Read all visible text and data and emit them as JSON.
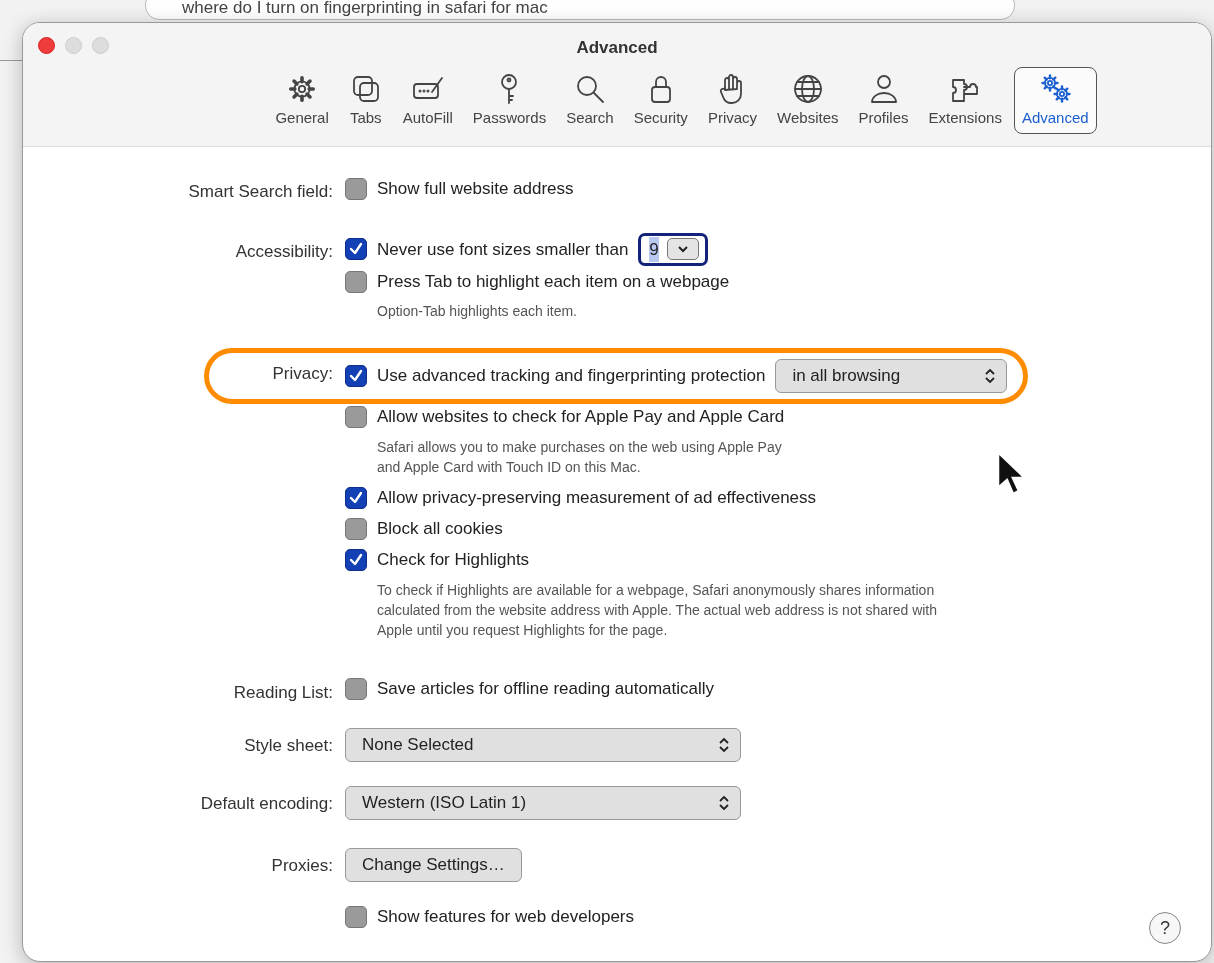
{
  "background": {
    "search_query": "where do I turn on fingerprinting in safari for mac"
  },
  "window": {
    "title": "Advanced"
  },
  "toolbar": [
    {
      "label": "General",
      "selected": false
    },
    {
      "label": "Tabs",
      "selected": false
    },
    {
      "label": "AutoFill",
      "selected": false
    },
    {
      "label": "Passwords",
      "selected": false
    },
    {
      "label": "Search",
      "selected": false
    },
    {
      "label": "Security",
      "selected": false
    },
    {
      "label": "Privacy",
      "selected": false
    },
    {
      "label": "Websites",
      "selected": false
    },
    {
      "label": "Profiles",
      "selected": false
    },
    {
      "label": "Extensions",
      "selected": false
    },
    {
      "label": "Advanced",
      "selected": true
    }
  ],
  "sections": [
    {
      "label": "Smart Search field:",
      "rows": [
        {
          "kind": "checkbox",
          "text": "Show full website address",
          "checked": false
        }
      ]
    },
    {
      "label": "Accessibility:",
      "rows": [
        {
          "kind": "checkbox",
          "text": "Never use font sizes smaller than",
          "checked": true,
          "stepper": {
            "value": "9"
          }
        },
        {
          "kind": "checkbox",
          "text": "Press Tab to highlight each item on a webpage",
          "checked": false,
          "note": "Option-Tab highlights each item."
        }
      ]
    },
    {
      "label": "Privacy:",
      "rows": [
        {
          "kind": "checkbox",
          "text": "Use advanced tracking and fingerprinting protection",
          "checked": true,
          "highlighted": true,
          "popup": {
            "value": "in all browsing"
          }
        },
        {
          "kind": "checkbox",
          "text": "Allow websites to check for Apple Pay and Apple Card",
          "checked": false,
          "note": "Safari allows you to make purchases on the web using Apple Pay\nand Apple Card with Touch ID on this Mac."
        },
        {
          "kind": "checkbox",
          "text": "Allow privacy-preserving measurement of ad effectiveness",
          "checked": true
        },
        {
          "kind": "checkbox",
          "text": "Block all cookies",
          "checked": false
        },
        {
          "kind": "checkbox",
          "text": "Check for Highlights",
          "checked": true,
          "note": "To check if Highlights are available for a webpage, Safari anonymously shares information\ncalculated from the website address with Apple. The actual web address is not shared with\nApple until you request Highlights for the page."
        }
      ]
    },
    {
      "label": "Reading List:",
      "rows": [
        {
          "kind": "checkbox",
          "text": "Save articles for offline reading automatically",
          "checked": false
        }
      ]
    },
    {
      "label": "Style sheet:",
      "rows": [
        {
          "kind": "popup",
          "text": "None Selected"
        }
      ]
    },
    {
      "label": "Default encoding:",
      "rows": [
        {
          "kind": "popup",
          "text": "Western (ISO Latin 1)"
        }
      ]
    },
    {
      "label": "Proxies:",
      "rows": [
        {
          "kind": "button",
          "text": "Change Settings…"
        }
      ]
    },
    {
      "rows": [
        {
          "kind": "checkbox",
          "text": "Show features for web developers",
          "checked": false
        }
      ]
    }
  ],
  "help_button": "?"
}
